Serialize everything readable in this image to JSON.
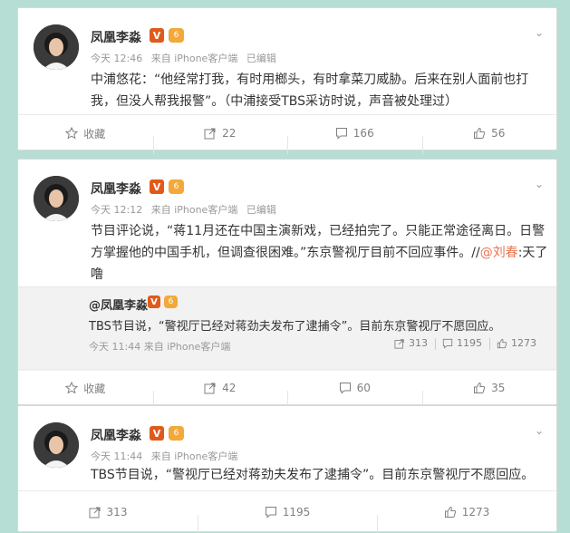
{
  "posts": [
    {
      "author": "凤凰李淼",
      "v_badge": "V",
      "level_badge": "6",
      "time": "今天 12:46",
      "source": "来自 iPhone客户端",
      "edited": "已编辑",
      "text": "中浦悠花：“他经常打我，有时用榔头，有时拿菜刀威胁。后来在别人面前也打我，但没人帮我报警”。（中浦接受TBS采访时说，声音被处理过）",
      "actions": {
        "favorite": "收藏",
        "repost": "22",
        "comment": "166",
        "like": "56"
      }
    },
    {
      "author": "凤凰李淼",
      "v_badge": "V",
      "level_badge": "6",
      "time": "今天 12:12",
      "source": "来自 iPhone客户端",
      "edited": "已编辑",
      "text_part1": "节目评论说，“蒋11月还在中国主演新戏，已经拍完了。只能正常途径离日。日警方掌握他的中国手机，但调查很困难。”东京警视厅目前不回应事件。//",
      "mention": "@刘春",
      "text_part2": ":天了噜",
      "repost": {
        "author": "@凤凰李淼",
        "v_badge": "V",
        "level_badge": "6",
        "text": "TBS节目说，“警视厅已经对蒋劲夫发布了逮捕令”。目前东京警视厅不愿回应。",
        "time": "今天 11:44",
        "source": "来自 iPhone客户端",
        "reposts": "313",
        "comments": "1195",
        "likes": "1273"
      },
      "actions": {
        "favorite": "收藏",
        "repost": "42",
        "comment": "60",
        "like": "35"
      }
    },
    {
      "author": "凤凰李淼",
      "v_badge": "V",
      "level_badge": "6",
      "time": "今天 11:44",
      "source": "来自 iPhone客户端",
      "text": "TBS节目说，“警视厅已经对蒋劲夫发布了逮捕令”。目前东京警视厅不愿回应。",
      "actions": {
        "repost": "313",
        "comment": "1195",
        "like": "1273"
      }
    }
  ],
  "colors": {
    "background": "#b6ded4",
    "mention": "#eb7350",
    "v_badge": "#e05a1b",
    "level_badge": "#f2a93a"
  },
  "icons": [
    "star-icon",
    "repost-icon",
    "comment-icon",
    "thumbs-up-icon",
    "chevron-down-icon"
  ]
}
